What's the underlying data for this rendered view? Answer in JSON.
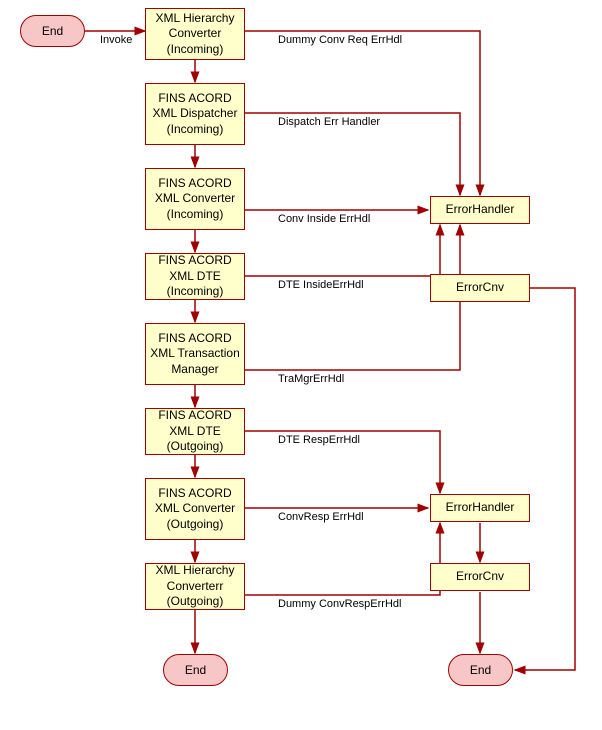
{
  "terminals": {
    "start": "End",
    "left_end": "End",
    "right_end": "End"
  },
  "main_flow": [
    "XML Hierarchy Converter (Incoming)",
    "FINS ACORD XML Dispatcher (Incoming)",
    "FINS ACORD XML Converter (Incoming)",
    "FINS ACORD XML DTE (Incoming)",
    "FINS ACORD XML Transaction Manager",
    "FINS ACORD XML DTE (Outgoing)",
    "FINS ACORD XML Converter (Outgoing)",
    "XML Hierarchy Converterr (Outgoing)"
  ],
  "right_nodes": {
    "err_handler_top": "ErrorHandler",
    "error_cnv_top": "ErrorCnv",
    "err_handler_bot": "ErrorHandler",
    "error_cnv_bot": "ErrorCnv"
  },
  "edge_labels": {
    "invoke": "Invoke",
    "dummy_conv_req": "Dummy Conv Req ErrHdl",
    "dispatch": "Dispatch Err Handler",
    "conv_inside": "Conv Inside ErrHdl",
    "dte_inside": "DTE InsideErrHdl",
    "tra_mgr": "TraMgrErrHdl",
    "dte_resp": "DTE RespErrHdl",
    "conv_resp": "ConvResp ErrHdl",
    "dummy_conv_resp": "Dummy ConvRespErrHdl"
  },
  "chart_data": {
    "type": "flowchart",
    "nodes": [
      {
        "id": "start",
        "type": "terminal",
        "label": "End"
      },
      {
        "id": "n0",
        "type": "process",
        "label": "XML Hierarchy Converter (Incoming)"
      },
      {
        "id": "n1",
        "type": "process",
        "label": "FINS ACORD XML Dispatcher (Incoming)"
      },
      {
        "id": "n2",
        "type": "process",
        "label": "FINS ACORD XML Converter (Incoming)"
      },
      {
        "id": "n3",
        "type": "process",
        "label": "FINS ACORD XML DTE (Incoming)"
      },
      {
        "id": "n4",
        "type": "process",
        "label": "FINS ACORD XML Transaction Manager"
      },
      {
        "id": "n5",
        "type": "process",
        "label": "FINS ACORD XML DTE (Outgoing)"
      },
      {
        "id": "n6",
        "type": "process",
        "label": "FINS ACORD XML Converter (Outgoing)"
      },
      {
        "id": "n7",
        "type": "process",
        "label": "XML Hierarchy Converterr (Outgoing)"
      },
      {
        "id": "left_end",
        "type": "terminal",
        "label": "End"
      },
      {
        "id": "err_top",
        "type": "process",
        "label": "ErrorHandler"
      },
      {
        "id": "cnv_top",
        "type": "process",
        "label": "ErrorCnv"
      },
      {
        "id": "err_bot",
        "type": "process",
        "label": "ErrorHandler"
      },
      {
        "id": "cnv_bot",
        "type": "process",
        "label": "ErrorCnv"
      },
      {
        "id": "right_end",
        "type": "terminal",
        "label": "End"
      }
    ],
    "edges": [
      {
        "from": "start",
        "to": "n0",
        "label": "Invoke"
      },
      {
        "from": "n0",
        "to": "n1"
      },
      {
        "from": "n1",
        "to": "n2"
      },
      {
        "from": "n2",
        "to": "n3"
      },
      {
        "from": "n3",
        "to": "n4"
      },
      {
        "from": "n4",
        "to": "n5"
      },
      {
        "from": "n5",
        "to": "n6"
      },
      {
        "from": "n6",
        "to": "n7"
      },
      {
        "from": "n7",
        "to": "left_end"
      },
      {
        "from": "n0",
        "to": "err_top",
        "label": "Dummy Conv Req ErrHdl"
      },
      {
        "from": "n1",
        "to": "err_top",
        "label": "Dispatch Err Handler"
      },
      {
        "from": "n2",
        "to": "err_top",
        "label": "Conv Inside ErrHdl"
      },
      {
        "from": "n3",
        "to": "err_top",
        "label": "DTE InsideErrHdl"
      },
      {
        "from": "n4",
        "to": "err_top",
        "label": "TraMgrErrHdl"
      },
      {
        "from": "n5",
        "to": "err_bot",
        "label": "DTE RespErrHdl"
      },
      {
        "from": "n6",
        "to": "err_bot",
        "label": "ConvResp ErrHdl"
      },
      {
        "from": "n7",
        "to": "err_bot",
        "label": "Dummy ConvRespErrHdl"
      },
      {
        "from": "err_bot",
        "to": "cnv_bot"
      },
      {
        "from": "cnv_bot",
        "to": "right_end"
      },
      {
        "from": "cnv_top",
        "to": "right_end"
      }
    ]
  }
}
